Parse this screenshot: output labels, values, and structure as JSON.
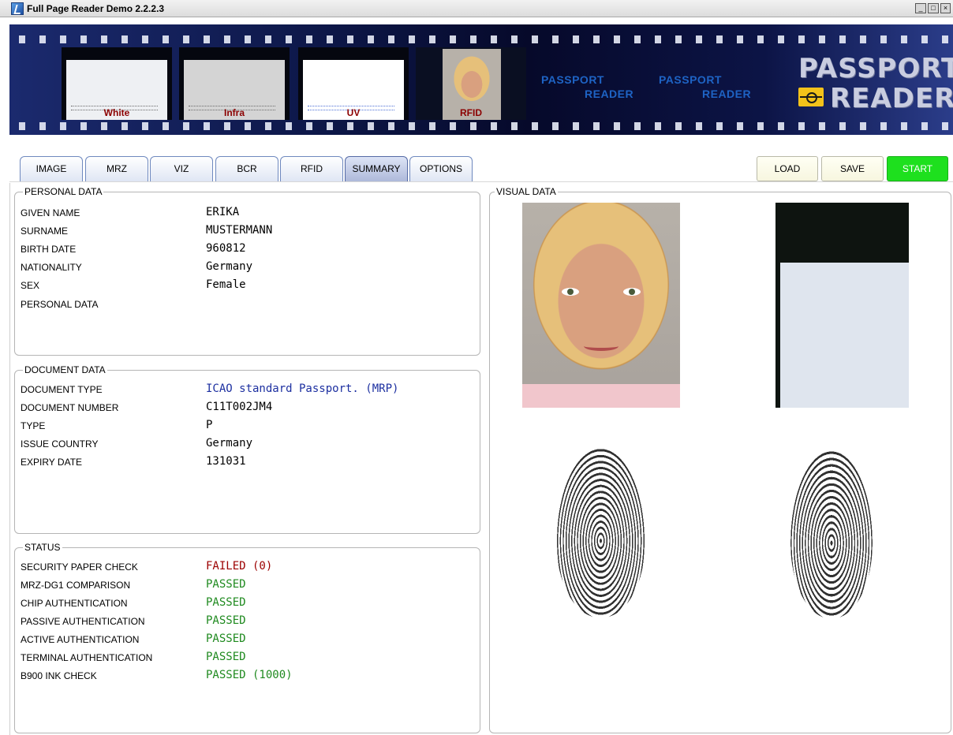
{
  "window": {
    "title": "Full Page Reader Demo 2.2.2.3",
    "controls": [
      "_",
      "□",
      "×"
    ]
  },
  "banner": {
    "frames": [
      {
        "label": "White"
      },
      {
        "label": "Infra"
      },
      {
        "label": "UV"
      },
      {
        "label": "RFID"
      }
    ],
    "mini_logo_top": "PASSPORT",
    "mini_logo_bottom": "READER",
    "big_logo_top": "PASSPORT",
    "big_logo_bottom": "READER"
  },
  "tabs": [
    {
      "label": "IMAGE"
    },
    {
      "label": "MRZ"
    },
    {
      "label": "VIZ"
    },
    {
      "label": "BCR"
    },
    {
      "label": "RFID"
    },
    {
      "label": "SUMMARY",
      "active": true
    },
    {
      "label": "OPTIONS"
    }
  ],
  "actions": {
    "load": "LOAD",
    "save": "SAVE",
    "start": "START"
  },
  "personal": {
    "title": "PERSONAL DATA",
    "rows": [
      {
        "label": "GIVEN NAME",
        "value": "ERIKA"
      },
      {
        "label": "SURNAME",
        "value": "MUSTERMANN"
      },
      {
        "label": "BIRTH DATE",
        "value": "960812"
      },
      {
        "label": "NATIONALITY",
        "value": "Germany"
      },
      {
        "label": "SEX",
        "value": "Female"
      },
      {
        "label": "PERSONAL DATA",
        "value": ""
      }
    ]
  },
  "document": {
    "title": "DOCUMENT DATA",
    "rows": [
      {
        "label": "DOCUMENT TYPE",
        "value": "ICAO standard Passport. (MRP)"
      },
      {
        "label": "DOCUMENT NUMBER",
        "value": "C11T002JM4"
      },
      {
        "label": "TYPE",
        "value": "P"
      },
      {
        "label": "ISSUE COUNTRY",
        "value": "Germany"
      },
      {
        "label": "EXPIRY DATE",
        "value": "131031"
      }
    ]
  },
  "status": {
    "title": "STATUS",
    "rows": [
      {
        "label": "SECURITY PAPER CHECK",
        "value": "FAILED (0)"
      },
      {
        "label": "MRZ-DG1 COMPARISON",
        "value": "PASSED"
      },
      {
        "label": "CHIP AUTHENTICATION",
        "value": "PASSED"
      },
      {
        "label": "PASSIVE AUTHENTICATION",
        "value": "PASSED"
      },
      {
        "label": "ACTIVE AUTHENTICATION",
        "value": "PASSED"
      },
      {
        "label": "TERMINAL AUTHENTICATION",
        "value": "PASSED"
      },
      {
        "label": "B900 INK CHECK",
        "value": "PASSED (1000)"
      }
    ]
  },
  "visual": {
    "title": "VISUAL DATA"
  },
  "colors": {
    "failed": "#9c0000",
    "passed": "#1f8a1f",
    "doc_type": "#1c2fa0",
    "start_button": "#1ee01e"
  }
}
